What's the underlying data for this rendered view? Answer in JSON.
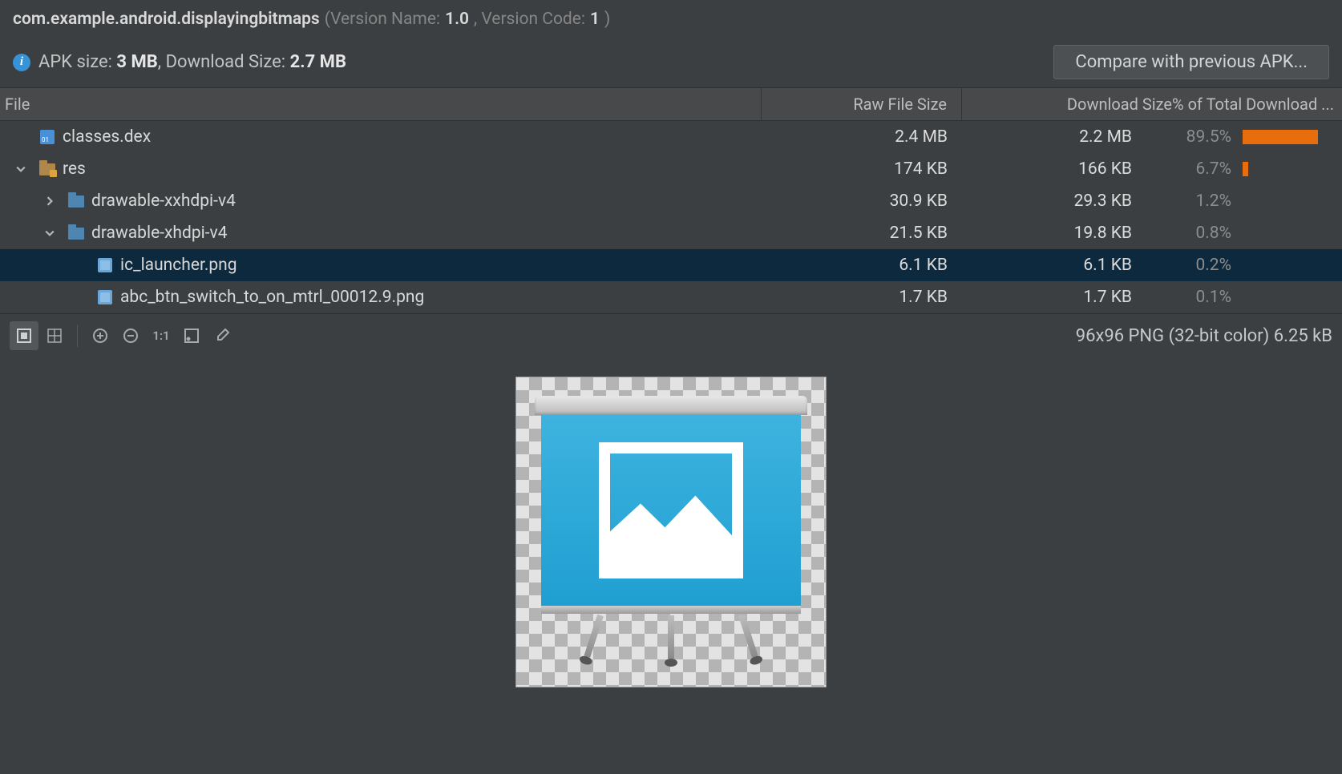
{
  "header": {
    "app_id": "com.example.android.displayingbitmaps",
    "version_name_label": "(Version Name:",
    "version_name": "1.0",
    "version_code_label": ", Version Code:",
    "version_code": "1",
    "version_close": ")",
    "apk_label": "APK size:",
    "apk_size": "3 MB",
    "dl_label": ", Download Size:",
    "dl_size": "2.7 MB",
    "compare_btn": "Compare with previous APK..."
  },
  "columns": {
    "file": "File",
    "raw": "Raw File Size",
    "dl": "Download Size% of Total Download ..."
  },
  "rows": [
    {
      "indent": 0,
      "arrow": "",
      "icon": "dex",
      "name": "classes.dex",
      "raw": "2.4 MB",
      "dl": "2.2 MB",
      "pct": "89.5%",
      "bar": 89.5,
      "selected": false
    },
    {
      "indent": 0,
      "arrow": "down",
      "icon": "res",
      "name": "res",
      "raw": "174 KB",
      "dl": "166 KB",
      "pct": "6.7%",
      "bar": 6.7,
      "selected": false
    },
    {
      "indent": 1,
      "arrow": "right",
      "icon": "folder",
      "name": "drawable-xxhdpi-v4",
      "raw": "30.9 KB",
      "dl": "29.3 KB",
      "pct": "1.2%",
      "bar": 0,
      "selected": false
    },
    {
      "indent": 1,
      "arrow": "down",
      "icon": "folder",
      "name": "drawable-xhdpi-v4",
      "raw": "21.5 KB",
      "dl": "19.8 KB",
      "pct": "0.8%",
      "bar": 0,
      "selected": false
    },
    {
      "indent": 2,
      "arrow": "",
      "icon": "img",
      "name": "ic_launcher.png",
      "raw": "6.1 KB",
      "dl": "6.1 KB",
      "pct": "0.2%",
      "bar": 0,
      "selected": true
    },
    {
      "indent": 2,
      "arrow": "",
      "icon": "img",
      "name": "abc_btn_switch_to_on_mtrl_00012.9.png",
      "raw": "1.7 KB",
      "dl": "1.7 KB",
      "pct": "0.1%",
      "bar": 0,
      "selected": false
    }
  ],
  "preview": {
    "status": "96x96 PNG (32-bit color) 6.25 kB"
  }
}
